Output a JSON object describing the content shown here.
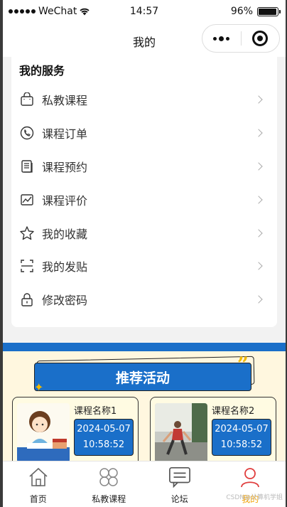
{
  "status_bar": {
    "carrier": "WeChat",
    "time": "14:57",
    "battery": "96%",
    "battery_level": 0.96
  },
  "nav": {
    "title": "我的"
  },
  "services": {
    "heading": "我的服务",
    "items": [
      {
        "label": "私教课程",
        "icon": "bag-icon"
      },
      {
        "label": "课程订单",
        "icon": "phone-circle-icon"
      },
      {
        "label": "课程预约",
        "icon": "document-icon"
      },
      {
        "label": "课程评价",
        "icon": "chart-icon"
      },
      {
        "label": "我的收藏",
        "icon": "star-icon"
      },
      {
        "label": "我的发贴",
        "icon": "scan-icon"
      },
      {
        "label": "修改密码",
        "icon": "lock-icon"
      }
    ]
  },
  "activity": {
    "title": "推荐活动",
    "cards": [
      {
        "name": "课程名称1",
        "date": "2024-05-07",
        "time": "10:58:52"
      },
      {
        "name": "课程名称2",
        "date": "2024-05-07",
        "time": "10:58:52"
      }
    ]
  },
  "tabbar": {
    "items": [
      {
        "label": "首页",
        "icon": "home-icon"
      },
      {
        "label": "私教课程",
        "icon": "clover-icon"
      },
      {
        "label": "论坛",
        "icon": "chat-icon"
      },
      {
        "label": "我的",
        "icon": "user-icon"
      }
    ],
    "active_index": 3
  },
  "watermark": "CSDN@计算机学姐",
  "colors": {
    "accent": "#1a6fc9",
    "active_tab": "#f2a100",
    "active_icon": "#e03d3d",
    "activity_bg": "#fff7df"
  }
}
